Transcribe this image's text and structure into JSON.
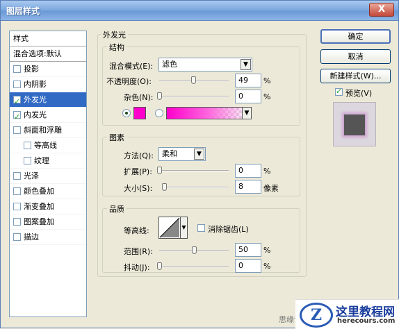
{
  "window": {
    "title": "图层样式",
    "close_label": "X"
  },
  "style_list": {
    "header": "样式",
    "blend_options": "混合选项:默认",
    "items": [
      {
        "label": "投影",
        "checked": false,
        "selected": false,
        "sub": false
      },
      {
        "label": "内阴影",
        "checked": false,
        "selected": false,
        "sub": false
      },
      {
        "label": "外发光",
        "checked": true,
        "selected": true,
        "sub": false
      },
      {
        "label": "内发光",
        "checked": true,
        "selected": false,
        "sub": false
      },
      {
        "label": "斜面和浮雕",
        "checked": false,
        "selected": false,
        "sub": false
      },
      {
        "label": "等高线",
        "checked": false,
        "selected": false,
        "sub": true
      },
      {
        "label": "纹理",
        "checked": false,
        "selected": false,
        "sub": true
      },
      {
        "label": "光泽",
        "checked": false,
        "selected": false,
        "sub": false
      },
      {
        "label": "颜色叠加",
        "checked": false,
        "selected": false,
        "sub": false
      },
      {
        "label": "渐变叠加",
        "checked": false,
        "selected": false,
        "sub": false
      },
      {
        "label": "图案叠加",
        "checked": false,
        "selected": false,
        "sub": false
      },
      {
        "label": "描边",
        "checked": false,
        "selected": false,
        "sub": false
      }
    ]
  },
  "outer_glow": {
    "title": "外发光",
    "structure": {
      "title": "结构",
      "blend_mode_label": "混合模式(E):",
      "blend_mode_value": "滤色",
      "opacity_label": "不透明度(O):",
      "opacity_value": "49",
      "opacity_unit": "%",
      "opacity_fraction": 0.49,
      "noise_label": "杂色(N):",
      "noise_value": "0",
      "noise_unit": "%",
      "noise_fraction": 0,
      "glow_color": "#ff00cc"
    },
    "elements": {
      "title": "图素",
      "method_label": "方法(Q):",
      "method_value": "柔和",
      "spread_label": "扩展(P):",
      "spread_value": "0",
      "spread_unit": "%",
      "spread_fraction": 0,
      "size_label": "大小(S):",
      "size_value": "8",
      "size_unit": "像素",
      "size_fraction": 0.03
    },
    "quality": {
      "title": "品质",
      "contour_label": "等高线:",
      "antialias_label": "消除锯齿(L)",
      "antialias_checked": false,
      "range_label": "范围(R):",
      "range_value": "50",
      "range_unit": "%",
      "range_fraction": 0.5,
      "jitter_label": "抖动(J):",
      "jitter_value": "0",
      "jitter_unit": "%",
      "jitter_fraction": 0
    }
  },
  "buttons": {
    "ok": "确定",
    "cancel": "取消",
    "new_style": "新建样式(W)...",
    "preview_label": "预览(V)",
    "preview_checked": true
  },
  "watermark": {
    "logo_letter": "Z",
    "title": "这里教程网",
    "url": "herecours.com",
    "side_text": "思缘论"
  }
}
